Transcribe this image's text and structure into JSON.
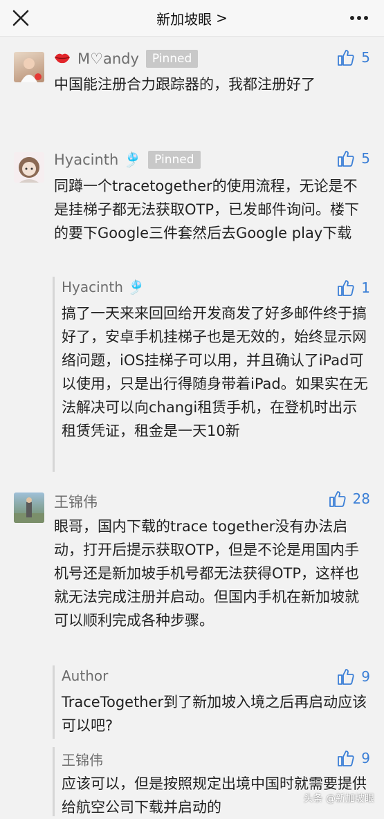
{
  "header": {
    "title": "新加坡眼",
    "title_chevron": ">",
    "close_icon": "close-icon",
    "more_icon": "more-horizontal-icon"
  },
  "comments": [
    {
      "nickname": "M♡andy",
      "nickname_prefix_icon": "lips-icon",
      "pinned_label": "Pinned",
      "likes": "5",
      "text": "中国能注册合力跟踪器的，我都注册好了"
    },
    {
      "nickname": "Hyacinth 🎐",
      "pinned_label": "Pinned",
      "likes": "5",
      "text": "同蹲一个tracetogether的使用流程，无论是不是挂梯子都无法获取OTP，已发邮件询问。楼下的要下Google三件套然后去Google play下载",
      "reply": {
        "nickname": "Hyacinth 🎐",
        "likes": "1",
        "text": "搞了一天来来回回给开发商发了好多邮件终于搞好了，安卓手机挂梯子也是无效的，始终显示网络问题，iOS挂梯子可以用，并且确认了iPad可以使用，只是出行得随身带着iPad。如果实在无法解决可以向changi租赁手机，在登机时出示租赁凭证，租金是一天10新"
      }
    },
    {
      "nickname": "王锦伟",
      "likes": "28",
      "text": "眼哥，国内下载的trace together没有办法启动，打开后提示获取OTP，但是不论是用国内手机号还是新加坡手机号都无法获得OTP，这样也就无法完成注册并启动。但国内手机在新加坡就可以顺利完成各种步骤。",
      "replies": [
        {
          "nickname": "Author",
          "likes": "9",
          "text": "TraceTogether到了新加坡入境之后再启动应该可以吧?"
        },
        {
          "nickname": "王锦伟",
          "likes": "9",
          "text": "应该可以，但是按照规定出境中国时就需要提供给航空公司下载并启动的"
        }
      ]
    }
  ],
  "watermark": "头条 @新加坡眼",
  "colors": {
    "accent": "#3b7fd6",
    "pinned_bg": "#c8c8c8",
    "background": "#f2f2f2"
  }
}
